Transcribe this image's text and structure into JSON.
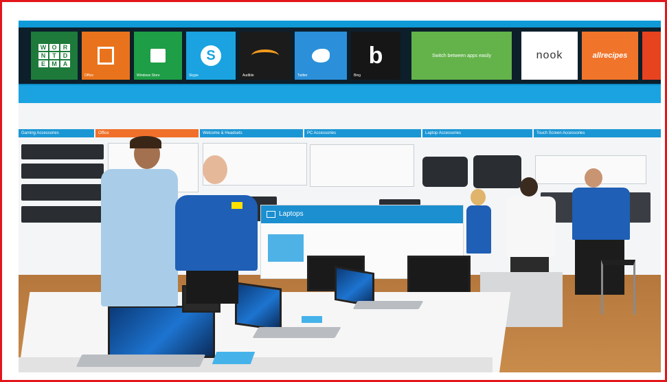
{
  "scene": {
    "accent_red": "#e3161b",
    "tiles": [
      {
        "name": "xbox-word-tile",
        "label": "WOR NTD EMA",
        "caption": "",
        "color": "#1d7a3a"
      },
      {
        "name": "office-tile",
        "label": "",
        "caption": "Office",
        "color": "#e9731c"
      },
      {
        "name": "windows-store-tile",
        "label": "",
        "caption": "Windows Store",
        "color": "#1e9e46"
      },
      {
        "name": "skype-tile",
        "label": "",
        "caption": "Skype",
        "color": "#1aa3e0"
      },
      {
        "name": "audible-tile",
        "label": "",
        "caption": "Audible",
        "color": "#1b1b1b"
      },
      {
        "name": "twitter-tile",
        "label": "",
        "caption": "Twitter",
        "color": "#2b90d9"
      },
      {
        "name": "bing-tile",
        "label": "b",
        "caption": "Bing",
        "color": "#161616"
      },
      {
        "name": "switch-apps-tile",
        "label": "Switch between apps easily",
        "caption": "",
        "color": "#63b34a"
      },
      {
        "name": "nook-tile",
        "label": "nook",
        "caption": "",
        "color": "#ffffff"
      },
      {
        "name": "allrecipes-tile",
        "label": "allrecipes",
        "caption": "",
        "color": "#f0752b"
      }
    ],
    "signs": [
      {
        "label": "Gaming Accessories"
      },
      {
        "label": "Office"
      },
      {
        "label": "Welcome & Headsets"
      },
      {
        "label": "PC Accessories"
      },
      {
        "label": "Laptop Accessories"
      },
      {
        "label": "Touch Screen Accessories"
      }
    ],
    "laptops_sign": "Laptops"
  }
}
